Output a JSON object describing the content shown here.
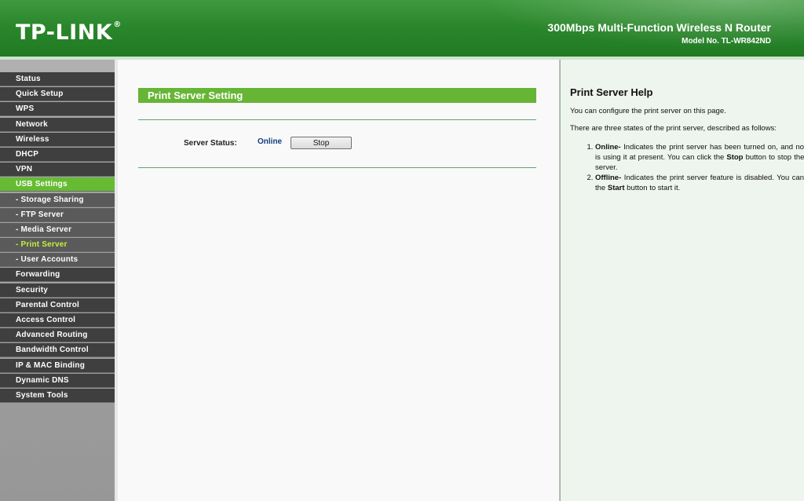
{
  "header": {
    "logo": "TP-LINK",
    "logo_mark": "®",
    "product": "300Mbps Multi-Function Wireless N Router",
    "model": "Model No. TL-WR842ND"
  },
  "sidebar": {
    "items": [
      {
        "label": "Status"
      },
      {
        "label": "Quick Setup"
      },
      {
        "label": "WPS"
      },
      {
        "label": "Network"
      },
      {
        "label": "Wireless"
      },
      {
        "label": "DHCP"
      },
      {
        "label": "VPN"
      },
      {
        "label": "USB Settings"
      },
      {
        "label": "- Storage Sharing"
      },
      {
        "label": "- FTP Server"
      },
      {
        "label": "- Media Server"
      },
      {
        "label": "- Print Server"
      },
      {
        "label": "- User Accounts"
      },
      {
        "label": "Forwarding"
      },
      {
        "label": "Security"
      },
      {
        "label": "Parental Control"
      },
      {
        "label": "Access Control"
      },
      {
        "label": "Advanced Routing"
      },
      {
        "label": "Bandwidth Control"
      },
      {
        "label": "IP & MAC Binding"
      },
      {
        "label": "Dynamic DNS"
      },
      {
        "label": "System Tools"
      }
    ]
  },
  "main": {
    "title": "Print Server Setting",
    "status_label": "Server Status:",
    "status_value": "Online",
    "stop_button": "Stop"
  },
  "help": {
    "title": "Print Server Help",
    "intro": "You can configure the print server on this page.",
    "states_intro": "There are three states of the print server, described as follows:",
    "online_term": "Online-",
    "online_text_a": " Indicates the print server has been turned on, and no user is using it at present. You can click the ",
    "online_button": "Stop",
    "online_text_b": " button to stop the print server.",
    "offline_term": "Offline-",
    "offline_text_a": " Indicates the print server feature is disabled. You can click the ",
    "offline_button": "Start",
    "offline_text_b": " button to start it."
  }
}
